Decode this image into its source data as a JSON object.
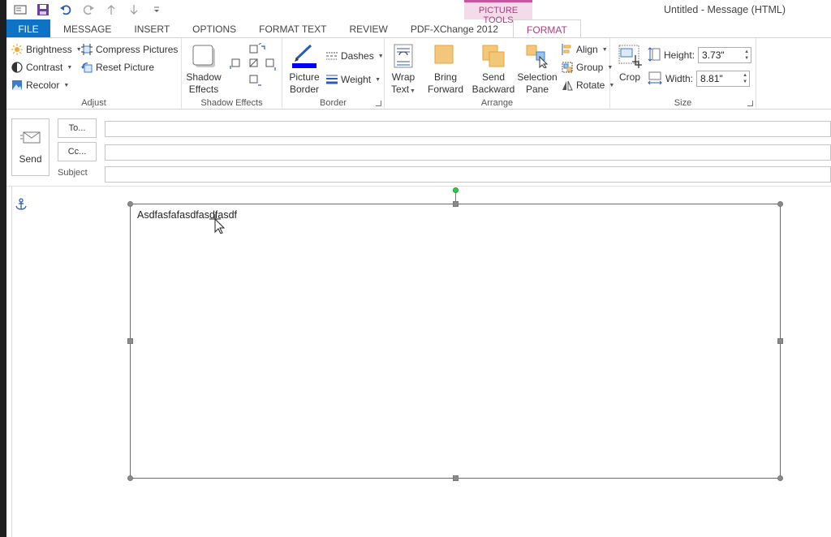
{
  "window": {
    "title": "Untitled - Message (HTML)"
  },
  "context_tab": {
    "group_label": "PICTURE TOOLS"
  },
  "quick_access": {
    "icons": [
      "new-item-icon",
      "save-icon",
      "undo-icon",
      "redo-icon",
      "up-arrow-icon",
      "down-arrow-icon",
      "customize-qat-icon"
    ]
  },
  "tabs": [
    {
      "label": "FILE"
    },
    {
      "label": "MESSAGE"
    },
    {
      "label": "INSERT"
    },
    {
      "label": "OPTIONS"
    },
    {
      "label": "FORMAT TEXT"
    },
    {
      "label": "REVIEW"
    },
    {
      "label": "PDF-XChange 2012"
    },
    {
      "label": "FORMAT",
      "active": true
    }
  ],
  "ribbon": {
    "adjust": {
      "label": "Adjust",
      "brightness": "Brightness",
      "contrast": "Contrast",
      "recolor": "Recolor",
      "compress": "Compress Pictures",
      "reset": "Reset Picture"
    },
    "shadow": {
      "label": "Shadow Effects",
      "shadow_line1": "Shadow",
      "shadow_line2": "Effects"
    },
    "border": {
      "label": "Border",
      "picture_border_line1": "Picture",
      "picture_border_line2": "Border",
      "dashes": "Dashes",
      "weight": "Weight"
    },
    "arrange": {
      "label": "Arrange",
      "wrap_line1": "Wrap",
      "wrap_line2": "Text",
      "bring_line1": "Bring",
      "bring_line2": "Forward",
      "send_line1": "Send",
      "send_line2": "Backward",
      "selection_line1": "Selection",
      "selection_line2": "Pane",
      "align": "Align",
      "group": "Group",
      "rotate": "Rotate"
    },
    "size": {
      "label": "Size",
      "crop": "Crop",
      "height_label": "Height:",
      "height_value": "3.73\"",
      "width_label": "Width:",
      "width_value": "8.81\""
    }
  },
  "header": {
    "send": "Send",
    "to": "To...",
    "cc": "Cc...",
    "subject": "Subject"
  },
  "body": {
    "picture_text": "Asdfasfafasdfasdfasdf"
  },
  "colors": {
    "file_tab": "#0e72c5",
    "context_accent": "#c7559b",
    "rotation_handle": "#2ecc40",
    "border_color_bar": "#0000ff"
  }
}
